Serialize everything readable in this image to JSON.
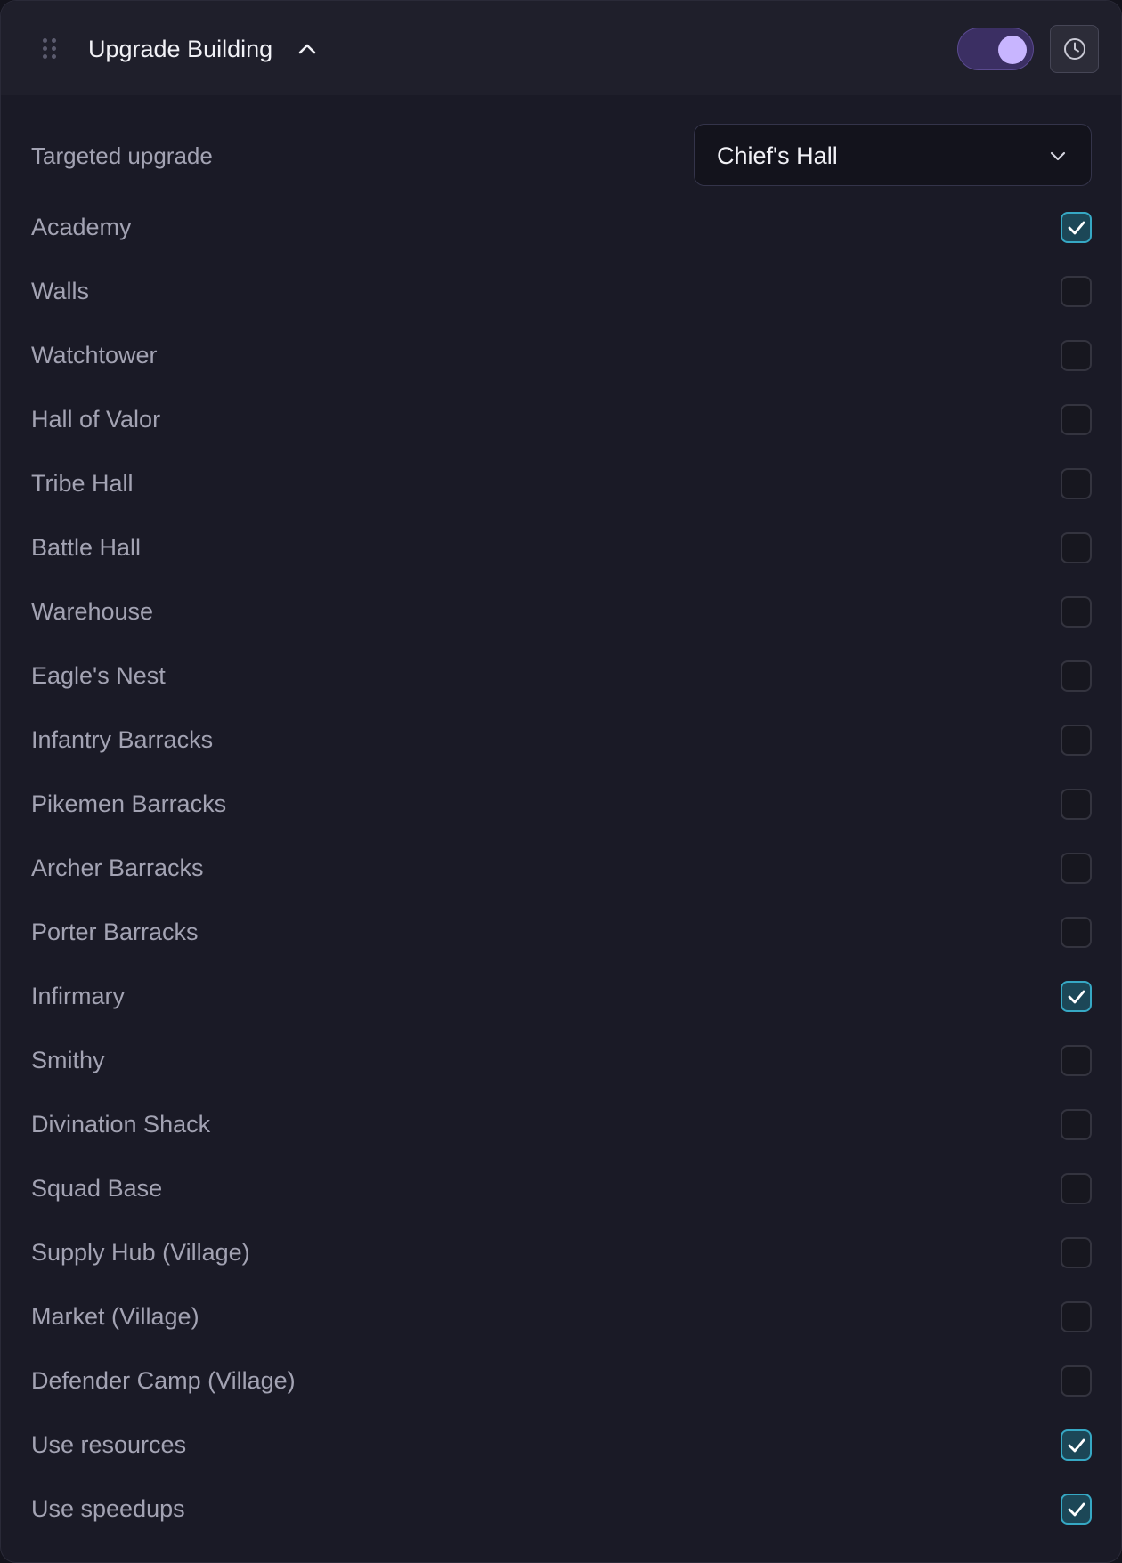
{
  "header": {
    "title": "Upgrade Building",
    "enabled": true
  },
  "target": {
    "label": "Targeted upgrade",
    "value": "Chief's Hall"
  },
  "items": [
    {
      "label": "Academy",
      "checked": true
    },
    {
      "label": "Walls",
      "checked": false
    },
    {
      "label": "Watchtower",
      "checked": false
    },
    {
      "label": "Hall of Valor",
      "checked": false
    },
    {
      "label": "Tribe Hall",
      "checked": false
    },
    {
      "label": "Battle Hall",
      "checked": false
    },
    {
      "label": "Warehouse",
      "checked": false
    },
    {
      "label": "Eagle's Nest",
      "checked": false
    },
    {
      "label": "Infantry Barracks",
      "checked": false
    },
    {
      "label": "Pikemen Barracks",
      "checked": false
    },
    {
      "label": "Archer Barracks",
      "checked": false
    },
    {
      "label": "Porter Barracks",
      "checked": false
    },
    {
      "label": "Infirmary",
      "checked": true
    },
    {
      "label": "Smithy",
      "checked": false
    },
    {
      "label": "Divination Shack",
      "checked": false
    },
    {
      "label": "Squad Base",
      "checked": false
    },
    {
      "label": "Supply Hub (Village)",
      "checked": false
    },
    {
      "label": "Market (Village)",
      "checked": false
    },
    {
      "label": "Defender Camp (Village)",
      "checked": false
    },
    {
      "label": "Use resources",
      "checked": true
    },
    {
      "label": "Use speedups",
      "checked": true
    }
  ],
  "colors": {
    "accent": "#36a8c4",
    "toggle_on": "#c8b5ff"
  }
}
